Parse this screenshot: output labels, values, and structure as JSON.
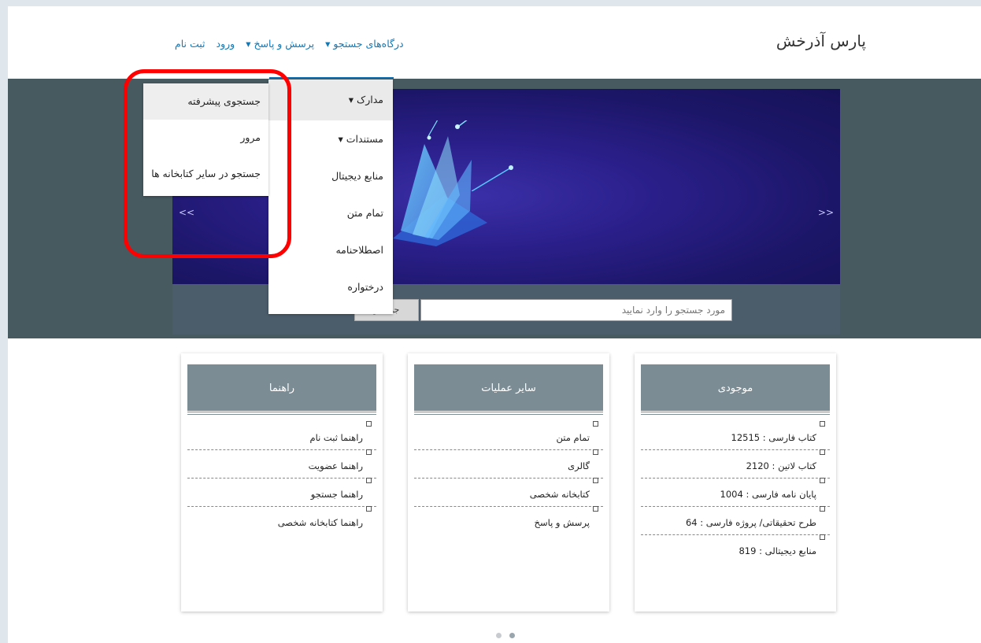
{
  "header": {
    "brand": "پارس آذرخش",
    "nav": [
      {
        "label": "درگاه‌های جستجو ▾"
      },
      {
        "label": "پرسش و پاسخ ▾"
      },
      {
        "label": "ورود"
      },
      {
        "label": "ثبت نام"
      }
    ]
  },
  "menu": {
    "main": [
      "مدارک ▾",
      "مستندات ▾",
      "منابع دیجیتال",
      "تمام متن",
      "اصطلاحنامه",
      "درختواره"
    ],
    "sub": [
      "جستجوی پیشرفته",
      "مرور",
      "جستجو در سایر کتابخانه ها"
    ]
  },
  "hero": {
    "arrow_left": "<<",
    "arrow_right": ">>"
  },
  "search": {
    "placeholder": "مورد جستجو را وارد نمایید",
    "button": "جستجو"
  },
  "cards": [
    {
      "title": "موجودی",
      "items": [
        "کتاب فارسی : 12515",
        "کتاب لاتین : 2120",
        "پایان نامه فارسی : 1004",
        "طرح تحقیقاتی/ پروژه فارسی : 64",
        "منابع دیجیتالی : 819"
      ]
    },
    {
      "title": "سایر عملیات",
      "items": [
        "تمام متن",
        "گالری",
        "کتابخانه شخصی",
        "پرسش و پاسخ"
      ]
    },
    {
      "title": "راهنما",
      "items": [
        "راهنما ثبت نام",
        "راهنما عضویت",
        "راهنما جستجو",
        "راهنما کتابخانه شخصی"
      ]
    }
  ],
  "colors": {
    "nav_link": "#1478b5",
    "hero_bg": "#465a60",
    "card_header": "#7c8c94",
    "highlight": "#ff0000"
  }
}
